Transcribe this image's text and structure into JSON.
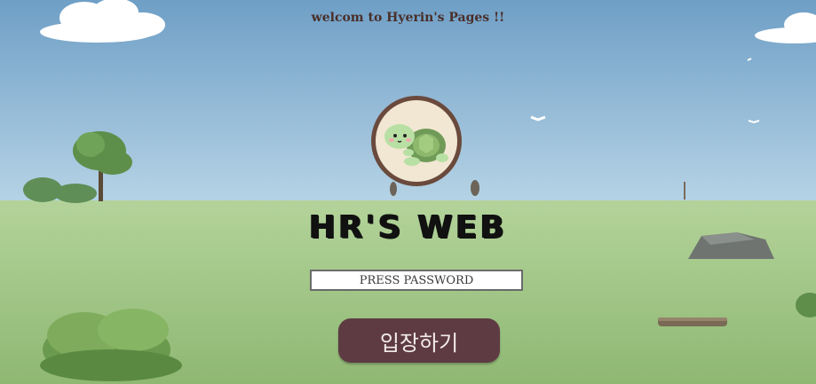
{
  "header": {
    "welcome_text": "welcom to Hyerin's Pages !!"
  },
  "hero": {
    "title": "HR'S WEB",
    "avatar_icon": "turtle-icon"
  },
  "login": {
    "password_placeholder": "PRESS PASSWORD",
    "enter_label": "입장하기"
  },
  "colors": {
    "sky": "#8fb8d6",
    "grass": "#a6c98a",
    "button": "#5e3b43",
    "title_text": "#111111"
  }
}
